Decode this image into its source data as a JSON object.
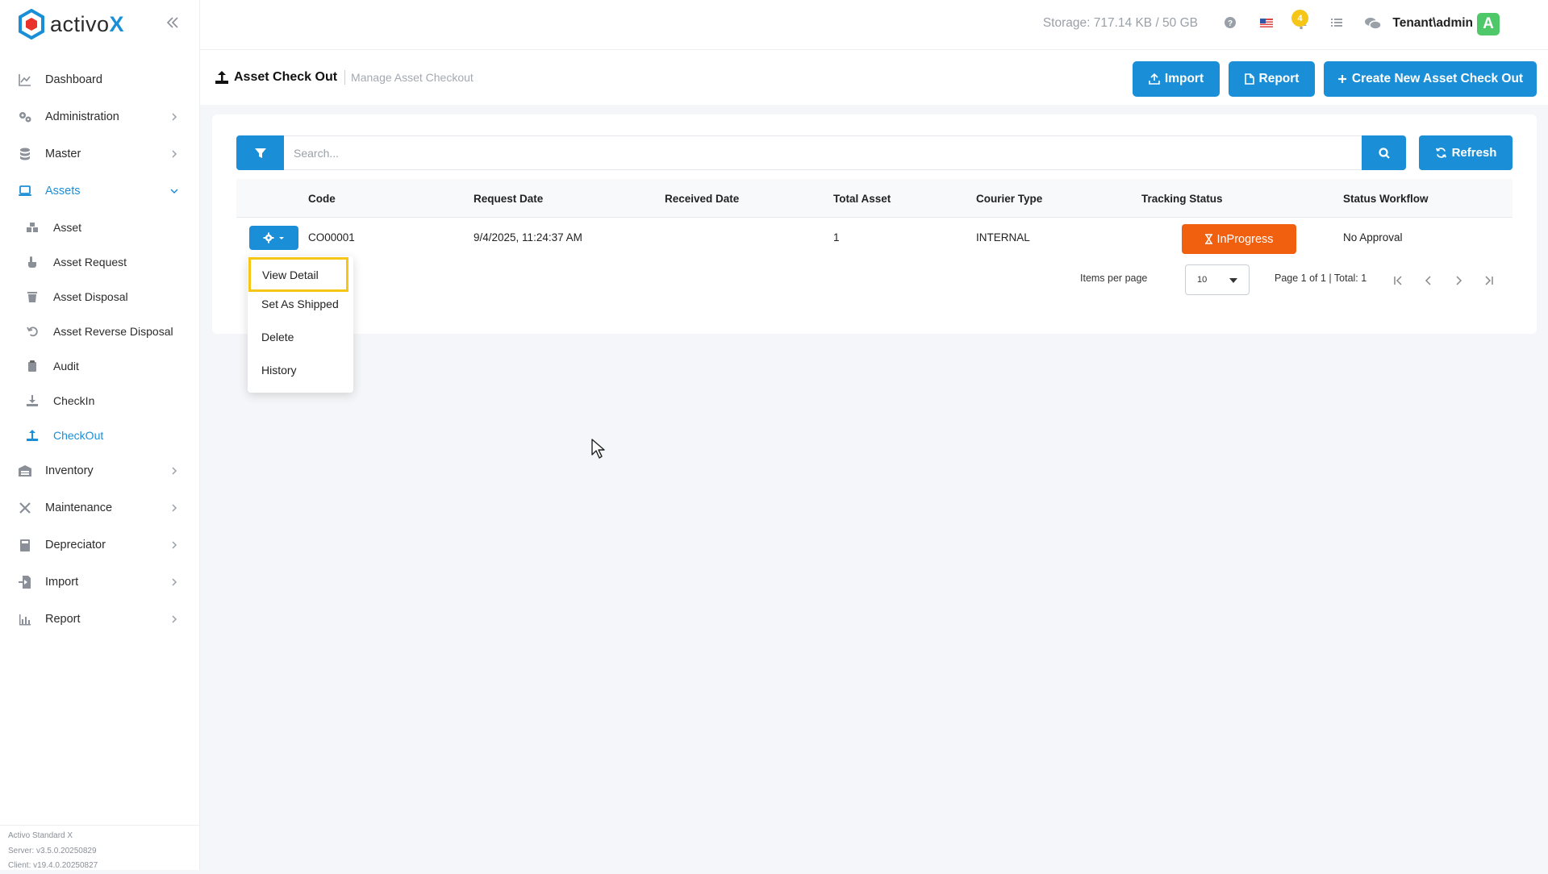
{
  "app": {
    "logo_text": "activo",
    "logo_x": "X"
  },
  "sidebar": {
    "items": [
      {
        "label": "Dashboard"
      },
      {
        "label": "Administration"
      },
      {
        "label": "Master"
      },
      {
        "label": "Assets"
      },
      {
        "label": "Inventory"
      },
      {
        "label": "Maintenance"
      },
      {
        "label": "Depreciator"
      },
      {
        "label": "Import"
      },
      {
        "label": "Report"
      }
    ],
    "assets_sub": [
      {
        "label": "Asset"
      },
      {
        "label": "Asset Request"
      },
      {
        "label": "Asset Disposal"
      },
      {
        "label": "Asset Reverse Disposal"
      },
      {
        "label": "Audit"
      },
      {
        "label": "CheckIn"
      },
      {
        "label": "CheckOut"
      }
    ],
    "footer": {
      "edition": "Activo Standard X",
      "server": "Server: v3.5.0.20250829",
      "client": "Client: v19.4.0.20250827"
    }
  },
  "header": {
    "storage": "Storage: 717.14 KB / 50 GB",
    "notifications_count": "4",
    "user": "Tenant\\admin",
    "avatar_letter": "A",
    "icons": [
      "help-icon",
      "flag-us-icon",
      "bell-icon",
      "list-icon",
      "chat-icon"
    ]
  },
  "page": {
    "title": "Asset Check Out",
    "subtitle": "Manage Asset Checkout",
    "import_label": "Import",
    "report_label": "Report",
    "create_label": "Create New Asset Check Out"
  },
  "search": {
    "placeholder": "Search...",
    "value": ""
  },
  "refresh_label": "Refresh",
  "table": {
    "columns": [
      "Code",
      "Request Date",
      "Received Date",
      "Total Asset",
      "Courier Type",
      "Tracking Status",
      "Status Workflow"
    ],
    "rows": [
      {
        "code": "CO00001",
        "request_date": "9/4/2025, 11:24:37 AM",
        "received_date": "",
        "total_asset": "1",
        "courier_type": "INTERNAL",
        "tracking_status": "InProgress",
        "status_workflow": "No Approval"
      }
    ]
  },
  "pagination": {
    "items_per_page_label": "Items per page",
    "items_per_page": "10",
    "summary": "Page 1 of 1 | Total: 1"
  },
  "row_menu": {
    "items": [
      {
        "label": "View Detail"
      },
      {
        "label": "Set As Shipped"
      },
      {
        "label": "Delete"
      },
      {
        "label": "History"
      }
    ]
  },
  "colors": {
    "primary": "#1a8fd8",
    "status_inprogress": "#f0600f",
    "highlight": "#f5c518",
    "avatar": "#4fc86a"
  }
}
